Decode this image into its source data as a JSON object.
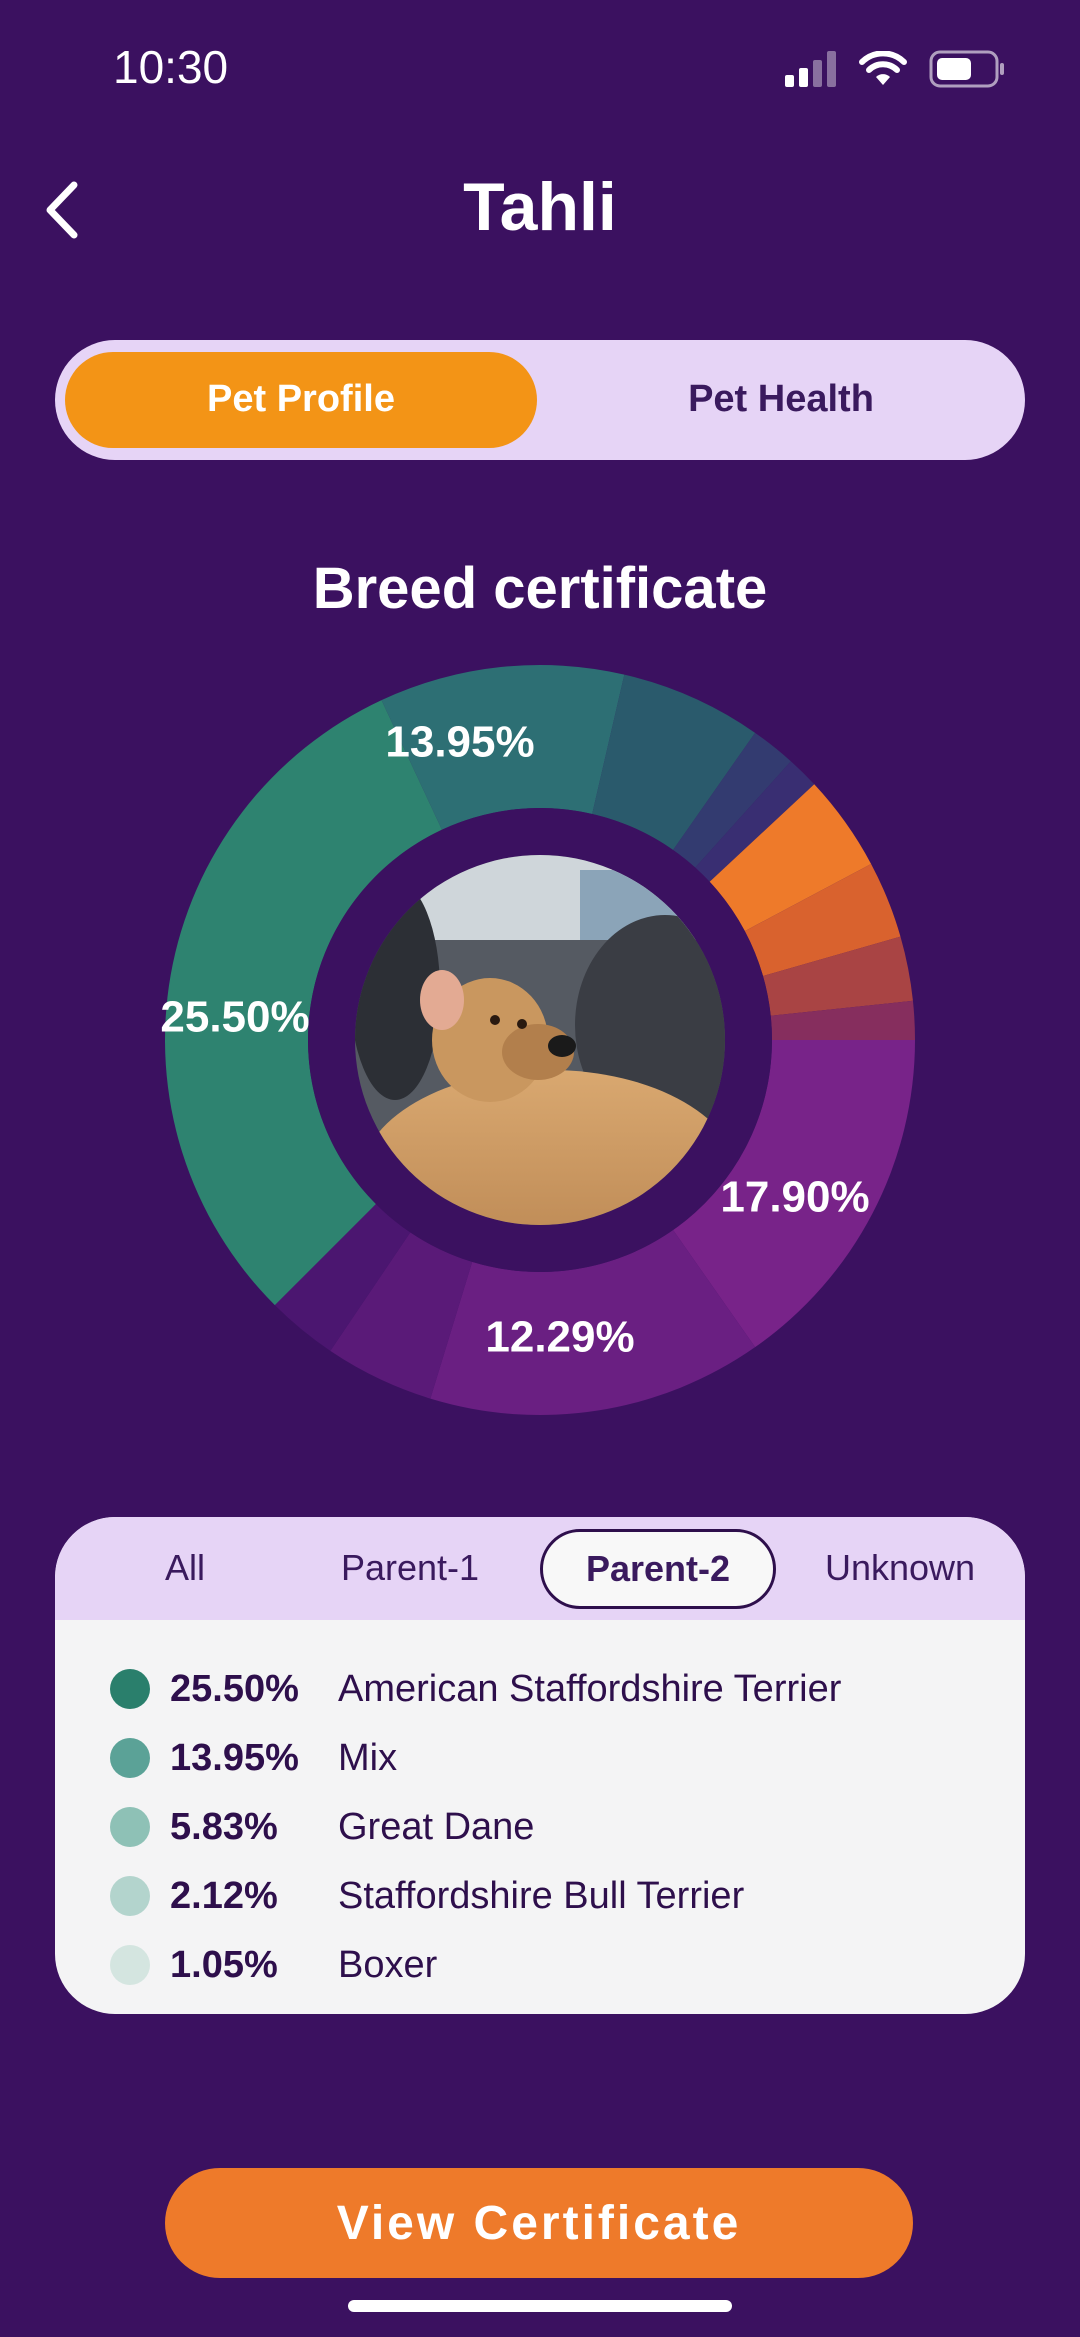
{
  "status_bar": {
    "time": "10:30"
  },
  "header": {
    "title": "Tahli"
  },
  "segment_tabs": [
    {
      "label": "Pet Profile",
      "active": true
    },
    {
      "label": "Pet Health",
      "active": false
    }
  ],
  "section": {
    "title": "Breed certificate"
  },
  "donut": {
    "labels": [
      "13.95%",
      "25.50%",
      "17.90%",
      "12.29%"
    ]
  },
  "filter_tabs": [
    {
      "label": "All"
    },
    {
      "label": "Parent-1"
    },
    {
      "label": "Parent-2",
      "active": true
    },
    {
      "label": "Unknown"
    }
  ],
  "legend": [
    {
      "pct": "25.50%",
      "breed": "American Staffordshire Terrier",
      "color": "#2a7f6c"
    },
    {
      "pct": "13.95%",
      "breed": "Mix",
      "color": "#5ba297"
    },
    {
      "pct": "5.83%",
      "breed": "Great Dane",
      "color": "#8ec1b6"
    },
    {
      "pct": "2.12%",
      "breed": "Staffordshire Bull Terrier",
      "color": "#b3d4cd"
    },
    {
      "pct": "1.05%",
      "breed": "Boxer",
      "color": "#d4e5e0"
    }
  ],
  "cta": {
    "label": "View Certificate"
  },
  "colors": {
    "background": "#3b1160",
    "accent": "#f39416",
    "cta": "#ee7a2a"
  }
}
